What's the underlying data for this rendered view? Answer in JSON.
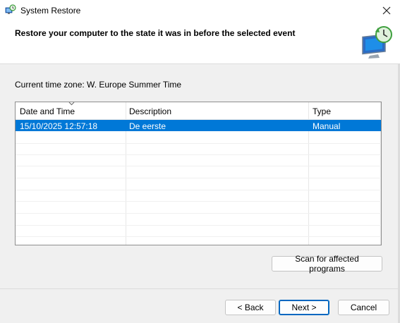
{
  "window": {
    "title": "System Restore",
    "close_symbol": "✕"
  },
  "header": {
    "heading": "Restore your computer to the state it was in before the selected event"
  },
  "timezone": "Current time zone: W. Europe Summer Time",
  "table": {
    "columns": [
      "Date and Time",
      "Description",
      "Type"
    ],
    "rows": [
      {
        "date": "15/10/2025 12:57:18",
        "description": "De eerste",
        "type": "Manual",
        "selected": true
      }
    ]
  },
  "buttons": {
    "scan": "Scan for affected programs",
    "back": "< Back",
    "next": "Next >",
    "cancel": "Cancel"
  },
  "colors": {
    "selection": "#0078d7",
    "accent_border": "#0067c0"
  }
}
